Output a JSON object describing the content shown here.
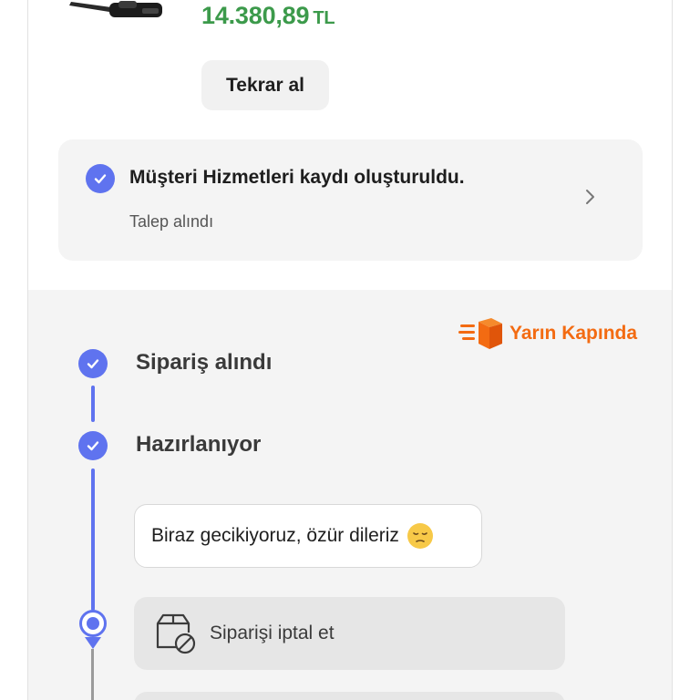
{
  "product": {
    "image_icon": "vacuum-product-image",
    "price_value": "14.380,89",
    "price_currency": "TL",
    "price_color": "#3c9a4b"
  },
  "reorder_button": {
    "label": "Tekrar al"
  },
  "support_card": {
    "title": "Müşteri Hizmetleri kaydı oluşturuldu.",
    "subtitle": "Talep alındı",
    "status_icon": "check-icon",
    "action_icon": "chevron-right-icon"
  },
  "delivery_badge": {
    "label": "Yarın Kapında",
    "icon": "fast-delivery-box-icon",
    "color": "#f36b12"
  },
  "tracking": {
    "accent_color": "#5f73ef",
    "steps": [
      {
        "label": "Sipariş alındı",
        "status": "completed"
      },
      {
        "label": "Hazırlanıyor",
        "status": "completed"
      }
    ],
    "delay_message": "Biraz gecikiyoruz, özür dileriz",
    "delay_emoji": "pensive-face-emoji",
    "cancel_label": "Siparişi iptal et",
    "cancel_icon": "box-cancel-icon"
  }
}
